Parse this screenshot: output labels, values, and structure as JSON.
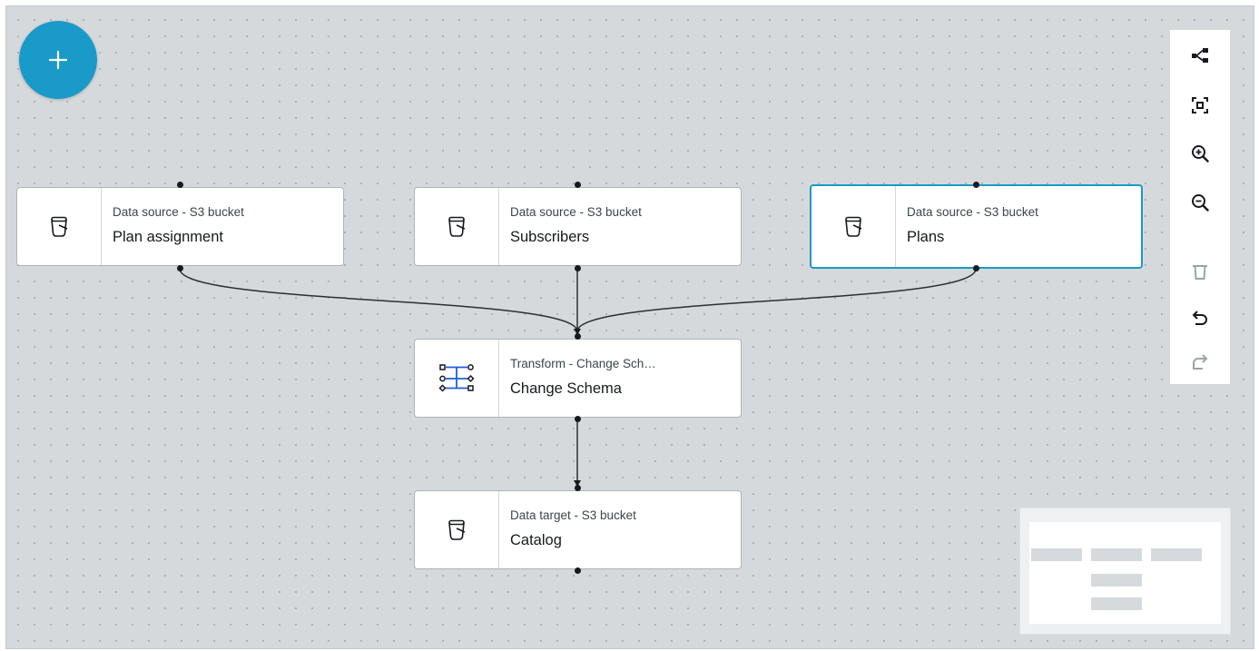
{
  "canvas": {
    "add_button_icon": "plus-icon",
    "nodes": [
      {
        "id": "plan-assignment",
        "type": "Data source - S3 bucket",
        "name": "Plan assignment",
        "icon": "s3-bucket-icon",
        "selected": false
      },
      {
        "id": "subscribers",
        "type": "Data source - S3 bucket",
        "name": "Subscribers",
        "icon": "s3-bucket-icon",
        "selected": false
      },
      {
        "id": "plans",
        "type": "Data source - S3 bucket",
        "name": "Plans",
        "icon": "s3-bucket-icon",
        "selected": true
      },
      {
        "id": "change-schema",
        "type": "Transform - Change Sch…",
        "name": "Change Schema",
        "icon": "change-schema-icon",
        "selected": false
      },
      {
        "id": "catalog",
        "type": "Data target - S3 bucket",
        "name": "Catalog",
        "icon": "s3-bucket-icon",
        "selected": false
      }
    ],
    "edges": [
      {
        "from": "plan-assignment",
        "to": "change-schema"
      },
      {
        "from": "subscribers",
        "to": "change-schema"
      },
      {
        "from": "plans",
        "to": "change-schema"
      },
      {
        "from": "change-schema",
        "to": "catalog"
      }
    ]
  },
  "toolbar": {
    "tools": [
      {
        "icon": "layout-icon",
        "enabled": true
      },
      {
        "icon": "fit-to-screen-icon",
        "enabled": true
      },
      {
        "icon": "zoom-in-icon",
        "enabled": true
      },
      {
        "icon": "zoom-out-icon",
        "enabled": true
      },
      {
        "icon": "delete-icon",
        "enabled": false
      },
      {
        "icon": "undo-icon",
        "enabled": true
      },
      {
        "icon": "redo-icon",
        "enabled": false
      }
    ]
  },
  "colors": {
    "accent": "#1a9ac9",
    "canvas_bg": "#d5d9dc",
    "icon_dark": "#16191f",
    "icon_disabled": "#9ba3ab",
    "transform_icon": "#1e5fd6"
  }
}
